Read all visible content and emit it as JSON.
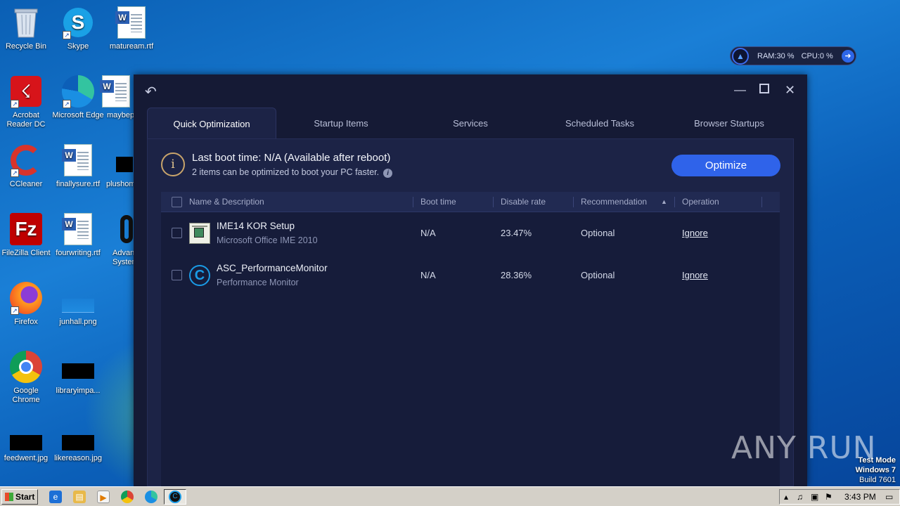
{
  "desktop": {
    "icons": [
      {
        "label": "Recycle Bin",
        "icon": "recycle-bin-icon"
      },
      {
        "label": "Skype",
        "icon": "skype-icon"
      },
      {
        "label": "matuream.rtf",
        "icon": "word-doc-icon"
      },
      {
        "label": "Acrobat Reader DC",
        "icon": "acrobat-icon"
      },
      {
        "label": "Microsoft Edge",
        "icon": "edge-icon"
      },
      {
        "label": "maybep...",
        "icon": "word-doc-icon"
      },
      {
        "label": "CCleaner",
        "icon": "ccleaner-icon"
      },
      {
        "label": "finallysure.rtf",
        "icon": "word-doc-icon"
      },
      {
        "label": "plushom...",
        "icon": "image-thumb-icon"
      },
      {
        "label": "FileZilla Client",
        "icon": "filezilla-icon"
      },
      {
        "label": "fourwriting.rtf",
        "icon": "word-doc-icon"
      },
      {
        "label": "Advan... System...",
        "icon": "advanced-systemcare-icon"
      },
      {
        "label": "Firefox",
        "icon": "firefox-icon"
      },
      {
        "label": "junhall.png",
        "icon": "image-thumb-icon"
      },
      {
        "label": "Google Chrome",
        "icon": "chrome-icon"
      },
      {
        "label": "libraryimpa...",
        "icon": "image-thumb-icon"
      },
      {
        "label": "feedwent.jpg",
        "icon": "image-thumb-icon"
      },
      {
        "label": "likereason.jpg",
        "icon": "image-thumb-icon"
      }
    ]
  },
  "widget": {
    "ram": "RAM:30 %",
    "cpu": "CPU:0 %"
  },
  "app": {
    "tabs": [
      {
        "label": "Quick Optimization",
        "active": true
      },
      {
        "label": "Startup Items",
        "active": false
      },
      {
        "label": "Services",
        "active": false
      },
      {
        "label": "Scheduled Tasks",
        "active": false
      },
      {
        "label": "Browser Startups",
        "active": false
      }
    ],
    "boot": {
      "title": "Last boot time: N/A (Available after reboot)",
      "count": "2",
      "subtitle_rest": " items can be optimized to boot your PC faster."
    },
    "optimize_label": "Optimize",
    "columns": {
      "name": "Name & Description",
      "boot": "Boot time",
      "disable": "Disable rate",
      "recommendation": "Recommendation",
      "operation": "Operation"
    },
    "rows": [
      {
        "name": "IME14 KOR Setup",
        "desc": "Microsoft Office IME 2010",
        "boot": "N/A",
        "disable": "23.47%",
        "recommendation": "Optional",
        "operation": "Ignore"
      },
      {
        "name": "ASC_PerformanceMonitor",
        "desc": "Performance Monitor",
        "boot": "N/A",
        "disable": "28.36%",
        "recommendation": "Optional",
        "operation": "Ignore"
      }
    ]
  },
  "watermark": "ANY RUN",
  "testmode": {
    "line1": "Test Mode",
    "line2": "Windows 7",
    "line3": "Build 7601"
  },
  "taskbar": {
    "start": "Start",
    "clock": "3:43 PM"
  }
}
